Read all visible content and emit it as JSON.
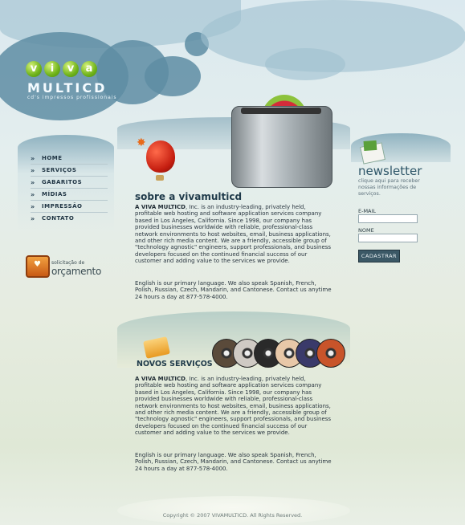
{
  "logo": {
    "letters": [
      "v",
      "i",
      "v",
      "a"
    ],
    "name": "MULTICD",
    "tagline": "cd's impressos profissionais"
  },
  "nav": {
    "items": [
      {
        "label": "HOME"
      },
      {
        "label": "SERVIÇOS"
      },
      {
        "label": "GABARITOS"
      },
      {
        "label": "MÍDIAS"
      },
      {
        "label": "IMPRESSÃO"
      },
      {
        "label": "CONTATO"
      }
    ],
    "bullet": "»"
  },
  "orcamento": {
    "small": "solicitação de",
    "big": "orçamento"
  },
  "sobre": {
    "title": "sobre a vivamulticd",
    "lead": "A VIVA MULTICD",
    "p1": ", Inc. is an industry-leading, privately held, profitable web hosting and software application services company based in Los Angeles, California. Since 1998, our company has provided businesses worldwide with reliable, professional-class network environments to host websites, email, business applications, and other rich media content. We are a friendly, accessible group of \"technology agnostic\" engineers, support professionals, and business developers focused on the continued financial success of our customer and adding value to the services we provide.",
    "p2": "English is our primary language. We also speak Spanish, French, Polish, Russian, Czech, Mandarin, and Cantonese. Contact us anytime 24 hours a day at 877-578-4000."
  },
  "novos": {
    "title": "NOVOS SERVIÇOS",
    "lead": "A VIVA MULTICD",
    "p1": ", Inc. is an industry-leading, privately held, profitable web hosting and software application services company based in Los Angeles, California. Since 1998, our company has provided businesses worldwide with reliable, professional-class network environments to host websites, email, business applications, and other rich media content. We are a friendly, accessible group of \"technology agnostic\" engineers, support professionals, and business developers focused on the continued financial success of our customer and adding value to the services we provide.",
    "p2": "English is our primary language. We also speak Spanish, French, Polish, Russian, Czech, Mandarin, and Cantonese. Contact us anytime 24 hours a day at 877-578-4000.",
    "cd_colors": [
      "#5a4a3a",
      "#cfcac4",
      "#2a2a2a",
      "#e8c8a8",
      "#3a3a6a",
      "#c8542a"
    ]
  },
  "newsletter": {
    "title": "newsletter",
    "subtitle": "clique aqui para receber nossas informações de serviços.",
    "email_label": "E-MAIL",
    "name_label": "NOME",
    "email_value": "",
    "name_value": "",
    "button": "CADASTRAR"
  },
  "footer": {
    "copyright": "Copyright © 2007 VIVAMULTICD. All Rights Reserved."
  }
}
